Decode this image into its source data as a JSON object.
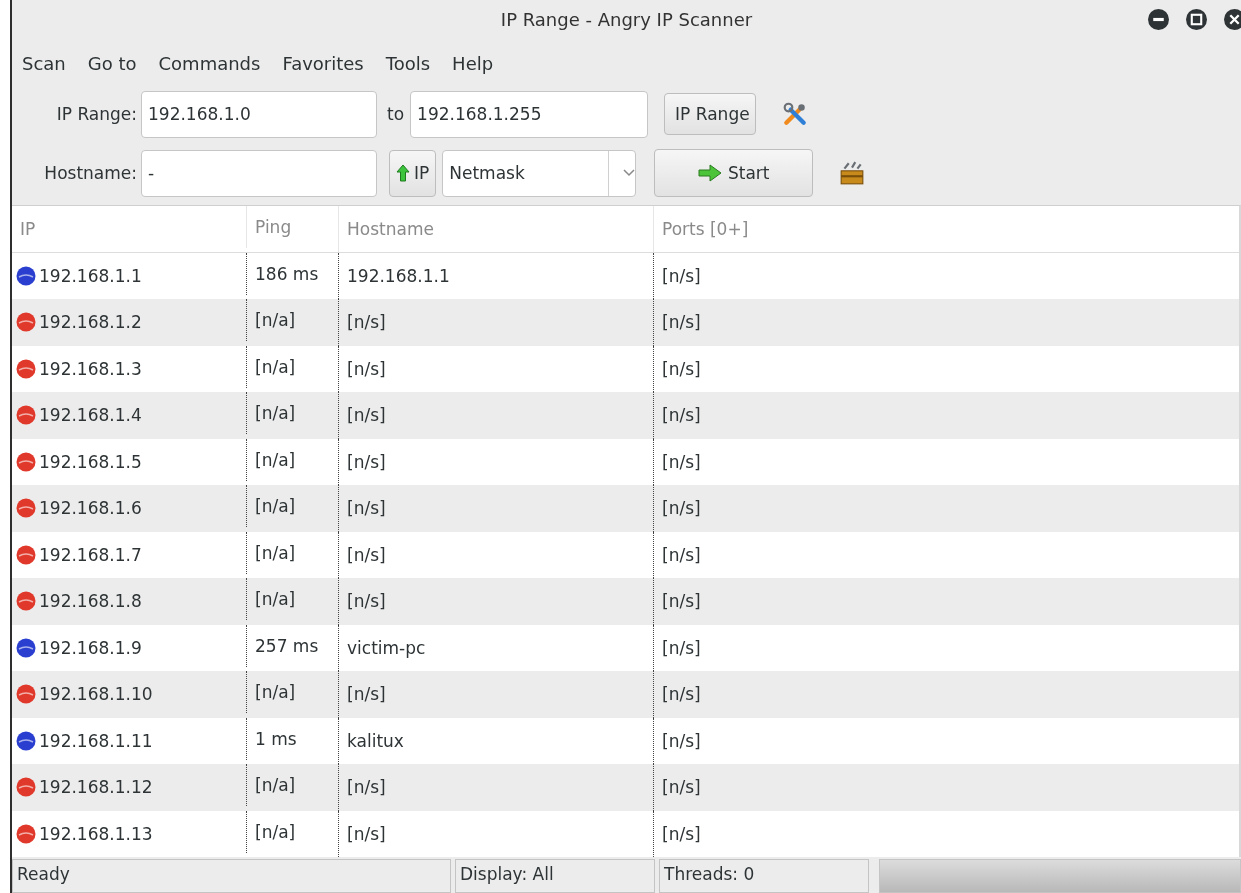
{
  "window": {
    "title": "IP Range - Angry IP Scanner"
  },
  "menu": [
    "Scan",
    "Go to",
    "Commands",
    "Favorites",
    "Tools",
    "Help"
  ],
  "toolbar": {
    "range_label": "IP Range:",
    "range_start": "192.168.1.0",
    "to_label": "to",
    "range_end": "192.168.1.255",
    "feeder": "IP Range",
    "hostname_label": "Hostname:",
    "hostname": "-",
    "ip_button": "IP",
    "netmask": "Netmask",
    "start_button": "Start"
  },
  "table": {
    "columns": [
      "IP",
      "Ping",
      "Hostname",
      "Ports [0+]"
    ],
    "rows": [
      {
        "ip": "192.168.1.1",
        "ping": "186 ms",
        "hostname": "192.168.1.1",
        "ports": "[n/s]",
        "color": "#2a3fd0"
      },
      {
        "ip": "192.168.1.2",
        "ping": "[n/a]",
        "hostname": "[n/s]",
        "ports": "[n/s]",
        "color": "#e0382a"
      },
      {
        "ip": "192.168.1.3",
        "ping": "[n/a]",
        "hostname": "[n/s]",
        "ports": "[n/s]",
        "color": "#e0382a"
      },
      {
        "ip": "192.168.1.4",
        "ping": "[n/a]",
        "hostname": "[n/s]",
        "ports": "[n/s]",
        "color": "#e0382a"
      },
      {
        "ip": "192.168.1.5",
        "ping": "[n/a]",
        "hostname": "[n/s]",
        "ports": "[n/s]",
        "color": "#e0382a"
      },
      {
        "ip": "192.168.1.6",
        "ping": "[n/a]",
        "hostname": "[n/s]",
        "ports": "[n/s]",
        "color": "#e0382a"
      },
      {
        "ip": "192.168.1.7",
        "ping": "[n/a]",
        "hostname": "[n/s]",
        "ports": "[n/s]",
        "color": "#e0382a"
      },
      {
        "ip": "192.168.1.8",
        "ping": "[n/a]",
        "hostname": "[n/s]",
        "ports": "[n/s]",
        "color": "#e0382a"
      },
      {
        "ip": "192.168.1.9",
        "ping": "257 ms",
        "hostname": "victim-pc",
        "ports": "[n/s]",
        "color": "#2a3fd0"
      },
      {
        "ip": "192.168.1.10",
        "ping": "[n/a]",
        "hostname": "[n/s]",
        "ports": "[n/s]",
        "color": "#e0382a"
      },
      {
        "ip": "192.168.1.11",
        "ping": "1 ms",
        "hostname": "kalitux",
        "ports": "[n/s]",
        "color": "#2a3fd0"
      },
      {
        "ip": "192.168.1.12",
        "ping": "[n/a]",
        "hostname": "[n/s]",
        "ports": "[n/s]",
        "color": "#e0382a"
      },
      {
        "ip": "192.168.1.13",
        "ping": "[n/a]",
        "hostname": "[n/s]",
        "ports": "[n/s]",
        "color": "#e0382a"
      }
    ]
  },
  "status_bar": {
    "status": "Ready",
    "display": "Display: All",
    "threads": "Threads: 0",
    "progress": {
      "level": 0
    }
  }
}
